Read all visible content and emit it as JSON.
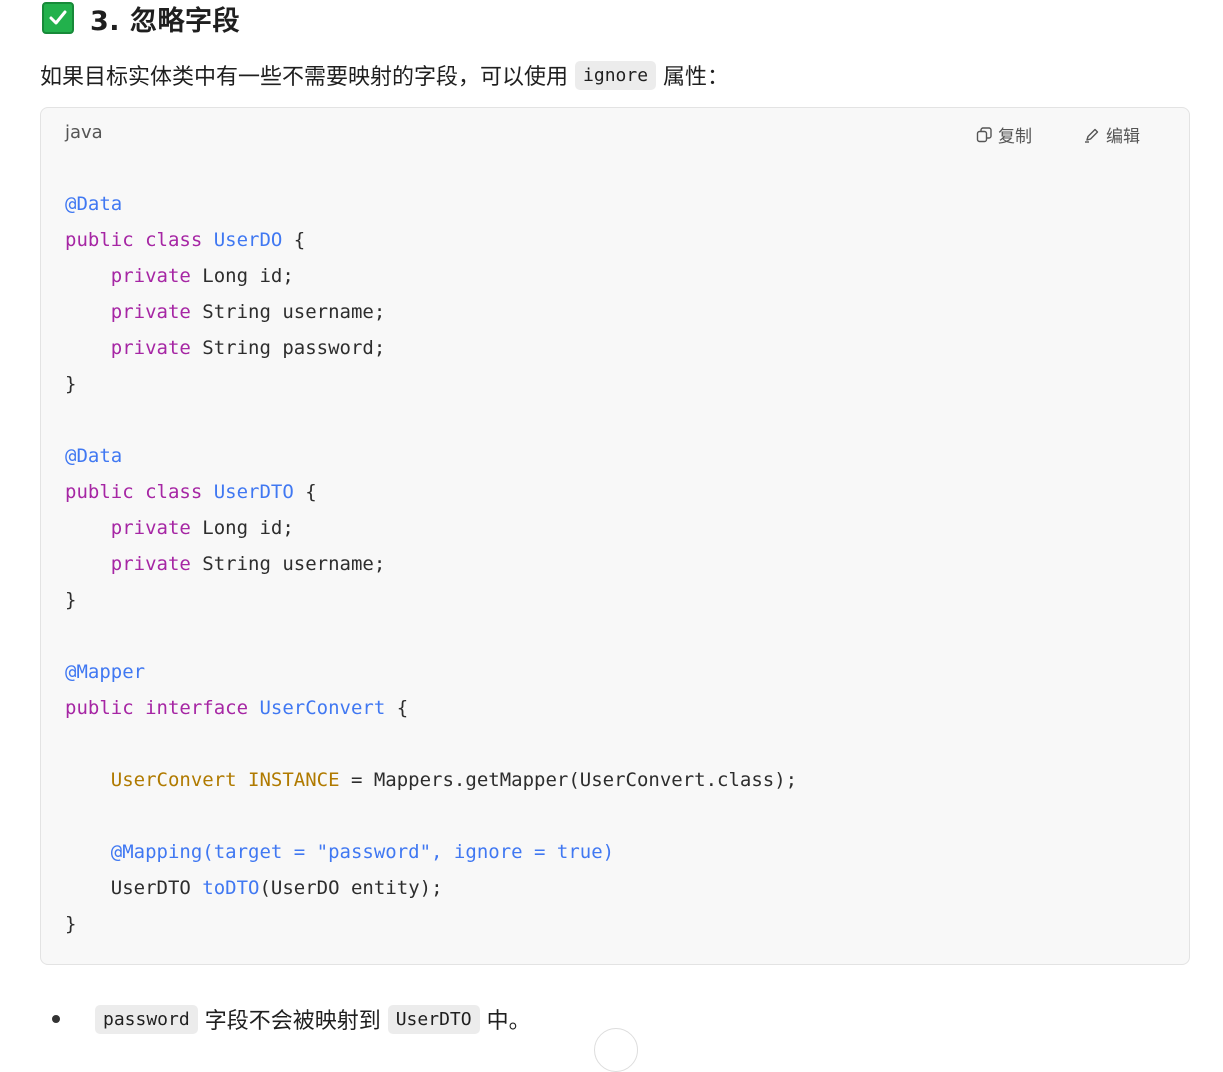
{
  "heading": {
    "title": "3. 忽略字段",
    "icon": "check-mark-button-icon",
    "icon_color": "#22b14c"
  },
  "intro": {
    "text_before": "如果目标实体类中有一些不需要映射的字段，可以使用",
    "code": "ignore",
    "text_after": "属性："
  },
  "code_block": {
    "language": "java",
    "copy_label": "复制",
    "edit_label": "编辑",
    "lines": [
      [
        {
          "t": "@Data",
          "c": "ann"
        }
      ],
      [
        {
          "t": "public class ",
          "c": "kw"
        },
        {
          "t": "UserDO",
          "c": "type"
        },
        {
          "t": " {",
          "c": "plain"
        }
      ],
      [
        {
          "t": "    ",
          "c": "plain"
        },
        {
          "t": "private",
          "c": "kw"
        },
        {
          "t": " Long id;",
          "c": "plain"
        }
      ],
      [
        {
          "t": "    ",
          "c": "plain"
        },
        {
          "t": "private",
          "c": "kw"
        },
        {
          "t": " String username;",
          "c": "plain"
        }
      ],
      [
        {
          "t": "    ",
          "c": "plain"
        },
        {
          "t": "private",
          "c": "kw"
        },
        {
          "t": " String password;",
          "c": "plain"
        }
      ],
      [
        {
          "t": "}",
          "c": "plain"
        }
      ],
      [],
      [
        {
          "t": "@Data",
          "c": "ann"
        }
      ],
      [
        {
          "t": "public class ",
          "c": "kw"
        },
        {
          "t": "UserDTO",
          "c": "type"
        },
        {
          "t": " {",
          "c": "plain"
        }
      ],
      [
        {
          "t": "    ",
          "c": "plain"
        },
        {
          "t": "private",
          "c": "kw"
        },
        {
          "t": " Long id;",
          "c": "plain"
        }
      ],
      [
        {
          "t": "    ",
          "c": "plain"
        },
        {
          "t": "private",
          "c": "kw"
        },
        {
          "t": " String username;",
          "c": "plain"
        }
      ],
      [
        {
          "t": "}",
          "c": "plain"
        }
      ],
      [],
      [
        {
          "t": "@Mapper",
          "c": "ann"
        }
      ],
      [
        {
          "t": "public interface ",
          "c": "kw"
        },
        {
          "t": "UserConvert",
          "c": "type"
        },
        {
          "t": " {",
          "c": "plain"
        }
      ],
      [],
      [
        {
          "t": "    ",
          "c": "plain"
        },
        {
          "t": "UserConvert INSTANCE",
          "c": "field"
        },
        {
          "t": " = Mappers.getMapper(UserConvert.class);",
          "c": "plain"
        }
      ],
      [],
      [
        {
          "t": "    ",
          "c": "plain"
        },
        {
          "t": "@Mapping(target = \"password\", ignore = true)",
          "c": "ann"
        }
      ],
      [
        {
          "t": "    UserDTO ",
          "c": "plain"
        },
        {
          "t": "toDTO",
          "c": "fn"
        },
        {
          "t": "(UserDO entity);",
          "c": "plain"
        }
      ],
      [
        {
          "t": "}",
          "c": "plain"
        }
      ]
    ]
  },
  "bullet": {
    "code1": "password",
    "text_middle": "字段不会被映射到",
    "code2": "UserDTO",
    "text_end": "中。"
  }
}
